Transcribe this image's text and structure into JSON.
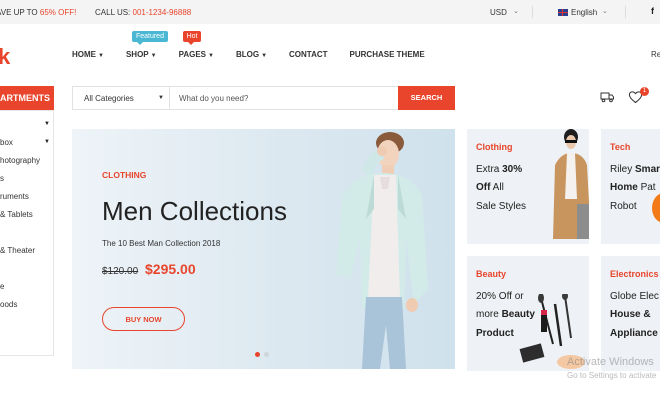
{
  "topbar": {
    "promo_prefix": "AVE UP TO ",
    "promo_highlight": "65% OFF!",
    "call_prefix": "CALL US: ",
    "call_number": "001-1234-96888",
    "currency": "USD",
    "language": "English",
    "social_icon_text": "f"
  },
  "header": {
    "logo": "k",
    "nav": [
      {
        "label": "HOME",
        "badge": ""
      },
      {
        "label": "SHOP",
        "badge": "Featured"
      },
      {
        "label": "PAGES",
        "badge": "Hot"
      },
      {
        "label": "BLOG",
        "badge": ""
      },
      {
        "label": "CONTACT",
        "badge": ""
      },
      {
        "label": "PURCHASE THEME",
        "badge": ""
      }
    ],
    "right_text": "Re"
  },
  "departments": {
    "title": "ARTMENTS",
    "items": [
      "box",
      "hotography",
      "s",
      "ruments",
      "& Tablets",
      "",
      "& Theater",
      "",
      "e",
      "oods"
    ]
  },
  "search": {
    "category": "All Categories",
    "placeholder": "What do you need?",
    "button": "SEARCH"
  },
  "wishlist_count": "1",
  "hero": {
    "kicker": "CLOTHING",
    "title": "Men Collections",
    "subtitle": "The 10 Best Man Collection 2018",
    "old_price": "$120.00",
    "new_price": "$295.00",
    "button": "BUY NOW"
  },
  "cards": {
    "clothing": {
      "title": "Clothing",
      "line1_a": "Extra ",
      "line1_b": "30%",
      "line2_a": "Off",
      "line2_b": " All",
      "line3": "Sale Styles"
    },
    "tech": {
      "title": "Tech",
      "line1_a": "Riley ",
      "line1_b": "Smar",
      "line2_a": "Home",
      "line2_b": " Pat",
      "line3": "Robot"
    },
    "beauty": {
      "title": "Beauty",
      "line1": "20% Off or",
      "line2_a": "more ",
      "line2_b": "Beauty",
      "line3": "Product"
    },
    "electronics": {
      "title": "Electronics",
      "line1": "Globe Elec",
      "line2": "House &",
      "line3": "Appliance"
    }
  },
  "watermark": {
    "line1": "Activate Windows",
    "line2": "Go to Settings to activate"
  },
  "colors": {
    "accent": "#e8452c",
    "featured": "#4bb8d3"
  }
}
